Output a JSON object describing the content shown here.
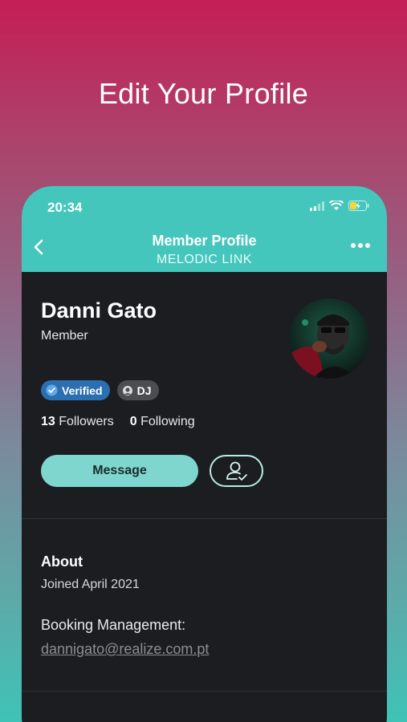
{
  "headline": "Edit Your Profile",
  "status_bar": {
    "time": "20:34"
  },
  "nav": {
    "title": "Member Profile",
    "subtitle": "MELODIC LINK"
  },
  "profile": {
    "name": "Danni Gato",
    "role": "Member",
    "badges": [
      {
        "label": "Verified",
        "icon": "check-circle-icon"
      },
      {
        "label": "DJ",
        "icon": "dj-badge-icon"
      }
    ],
    "followers_count": "13",
    "followers_label": "Followers",
    "following_count": "0",
    "following_label": "Following",
    "message_label": "Message"
  },
  "about": {
    "title": "About",
    "joined": "Joined April 2021",
    "booking_label": "Booking Management:",
    "email": "dannigato@realize.com.pt"
  },
  "colors": {
    "accent": "#45c6bd",
    "button": "#7ed6cf",
    "background": "#1b1d21",
    "verified": "#2b6fb0"
  }
}
